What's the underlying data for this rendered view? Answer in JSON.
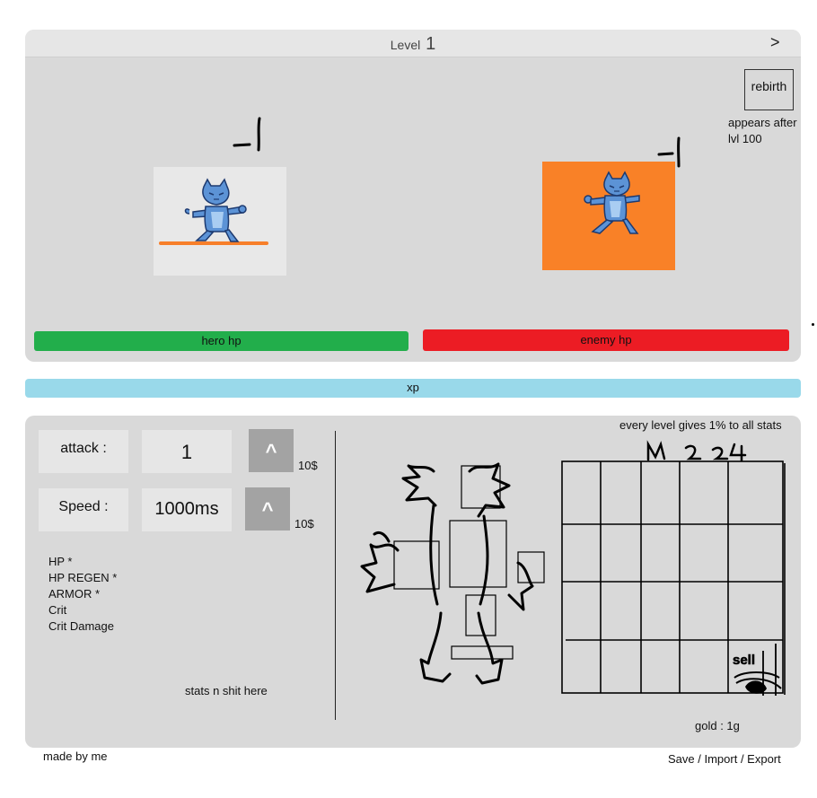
{
  "header": {
    "level_word": "Level",
    "level_number": "1",
    "next_label": ">"
  },
  "rebirth": {
    "button_label": "rebirth",
    "note": "appears after lvl 100"
  },
  "combat": {
    "hero_damage_text": "-1",
    "enemy_damage_text": "-1",
    "hero_hp_label": "hero hp",
    "enemy_hp_label": "enemy hp",
    "hero_hp_color": "#22ae4b",
    "enemy_hp_color": "#ec1c24",
    "enemy_bg_color": "#f98127",
    "hero_sprite_icon": "cat-hero-icon",
    "enemy_sprite_icon": "cat-enemy-icon"
  },
  "xp": {
    "label": "xp",
    "color": "#99d9ea"
  },
  "upgrades": [
    {
      "label": "attack :",
      "value": "1",
      "button": "^",
      "cost": "10$"
    },
    {
      "label": "Speed :",
      "value": "1000ms",
      "button": "^",
      "cost": "10$"
    }
  ],
  "stats_list": [
    "HP *",
    "HP REGEN *",
    "ARMOR *",
    "Crit",
    "Crit Damage"
  ],
  "stats_placeholder": "stats n shit here",
  "level_bonus": "every level gives 1% to all stats",
  "inventory": {
    "sketch_scrawl": "m 2 24",
    "sell_label": "sell all",
    "gold": "gold : 1g"
  },
  "footer": {
    "credit": "made by me",
    "save": "Save",
    "import": "Import",
    "export": "Export",
    "sep": " / "
  }
}
